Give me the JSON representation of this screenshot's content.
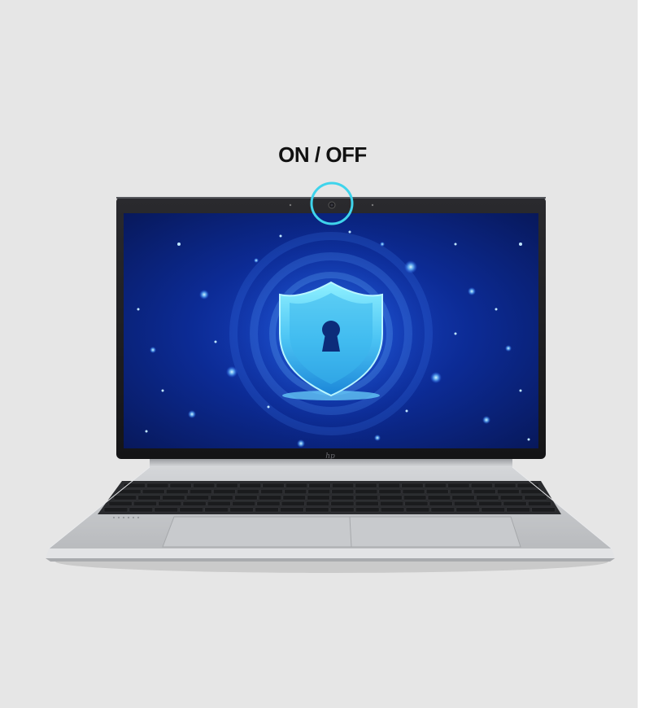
{
  "callout": {
    "label": "ON / OFF",
    "ring_color": "#3fd4ec"
  },
  "screen": {
    "wallpaper_icon": "shield-keyhole-icon",
    "bg_color": "#0a1a6e",
    "glow_color": "#5fd8ff"
  },
  "brand_logo_icon": "hp-logo-icon"
}
